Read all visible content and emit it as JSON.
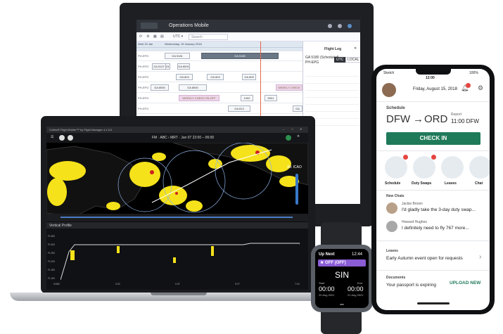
{
  "desktop": {
    "app_title": "Operations Mobile",
    "toolbar": {
      "timezone": "UTC ▾",
      "search_placeholder": "Search"
    },
    "date_header": "Wed 15 Jan",
    "date_sub": "Wednesday, 15 January 2018",
    "gantt_rows": [
      {
        "reg": "PH-EPG",
        "bars": [
          {
            "label": "GA 5180",
            "style": "dark"
          },
          {
            "label": "GA 5181"
          }
        ]
      },
      {
        "reg": "PH-EPG",
        "bars": [
          {
            "label": "GA 8001"
          },
          {
            "label": "GA 5107"
          },
          {
            "label": "GA 8001"
          }
        ]
      },
      {
        "reg": "PH-EPG",
        "bars": [
          {
            "label": "GA 804"
          },
          {
            "label": "GA 804"
          },
          {
            "label": "GA 805"
          }
        ]
      },
      {
        "reg": "PH-EPG",
        "bars": [
          {
            "label": "GA 8500"
          },
          {
            "label": "GA 8500"
          },
          {
            "label": "WEEKLY CHECK PA-OFF",
            "style": "pink"
          }
        ]
      },
      {
        "reg": "PH-EPG",
        "bars": [
          {
            "label": "WEEKLY CHECK PA-OFF",
            "style": "pink"
          },
          {
            "label": "1002"
          },
          {
            "label": "5001"
          }
        ]
      },
      {
        "reg": "PH-EPG",
        "bars": [
          {
            "label": "GA 813"
          },
          {
            "label": "GA 8505"
          }
        ]
      },
      {
        "reg": "PH-EPG",
        "bars": [
          {
            "label": "GA 873"
          },
          {
            "label": "GA 877"
          }
        ]
      },
      {
        "reg": "PH-EPG",
        "bars": [
          {
            "label": "602"
          },
          {
            "label": "417"
          },
          {
            "label": "GA 8801"
          }
        ]
      }
    ],
    "flight_log": {
      "title": "Flight Log",
      "flight": "GA 5180 (Scheduled)",
      "sub": "PH-EPG",
      "tabs": [
        "UTC",
        "LOCAL"
      ]
    }
  },
  "laptop": {
    "window_title": "Collins® Flight Briefer™ by Flight Manager 4.1.5.0",
    "map_header": "FM · ABC › MRT · Jun 07 22:00 – 06:00",
    "layer_label": "Alt: ICAO",
    "vp_title": "Vertical Profile",
    "vp_yticks": [
      "FL350",
      "FL300",
      "FL250",
      "FL200",
      "FL150",
      "FL100"
    ],
    "vp_xticks": [
      "KABC",
      "0:32",
      "0:47",
      "5:27",
      "7:01"
    ]
  },
  "phone": {
    "status_time": "12:00",
    "status_carrier": "Sketch",
    "status_battery": "100%",
    "date": "Friday, August 15, 2018",
    "schedule_label": "Schedule",
    "route_from": "DFW",
    "route_to": "ORD",
    "report_label": "Report",
    "report_time": "11:00 DFW",
    "checkin_label": "CHECK IN",
    "shortcuts": [
      {
        "label": "Schedule",
        "icon": "calendar-icon",
        "badge": "1"
      },
      {
        "label": "Duty Swaps",
        "icon": "people-icon",
        "badge": "1"
      },
      {
        "label": "Leaves",
        "icon": "suitcase-icon",
        "badge": ""
      },
      {
        "label": "Chat",
        "icon": "chat-icon",
        "badge": ""
      }
    ],
    "chats_title": "New Chats",
    "chats": [
      {
        "name": "Jackie Brown",
        "msg": "I'd gladly take the 3-day duty swap..."
      },
      {
        "name": "Howard Hughes",
        "msg": "I definitely need to fly 767 more..."
      }
    ],
    "leaves_title": "Leaves",
    "leaves_msg": "Early Autumn event open for requests",
    "docs_title": "Documents",
    "docs_msg": "Your passport is expiring",
    "docs_action": "UPLOAD NEW"
  },
  "watch": {
    "header": "Up Next",
    "time": "12:44",
    "status": "OFF (OFF)",
    "airport": "SIN",
    "start_label": "Start",
    "end_label": "End",
    "start_time": "00:00",
    "end_time": "00:00",
    "start_date": "20 Aug 2021",
    "end_date": "21 Aug 2021"
  },
  "colors": {
    "accent_green": "#1f7a5a",
    "watch_purple": "#8a5cd6",
    "weather_yellow": "#f5e21a"
  }
}
